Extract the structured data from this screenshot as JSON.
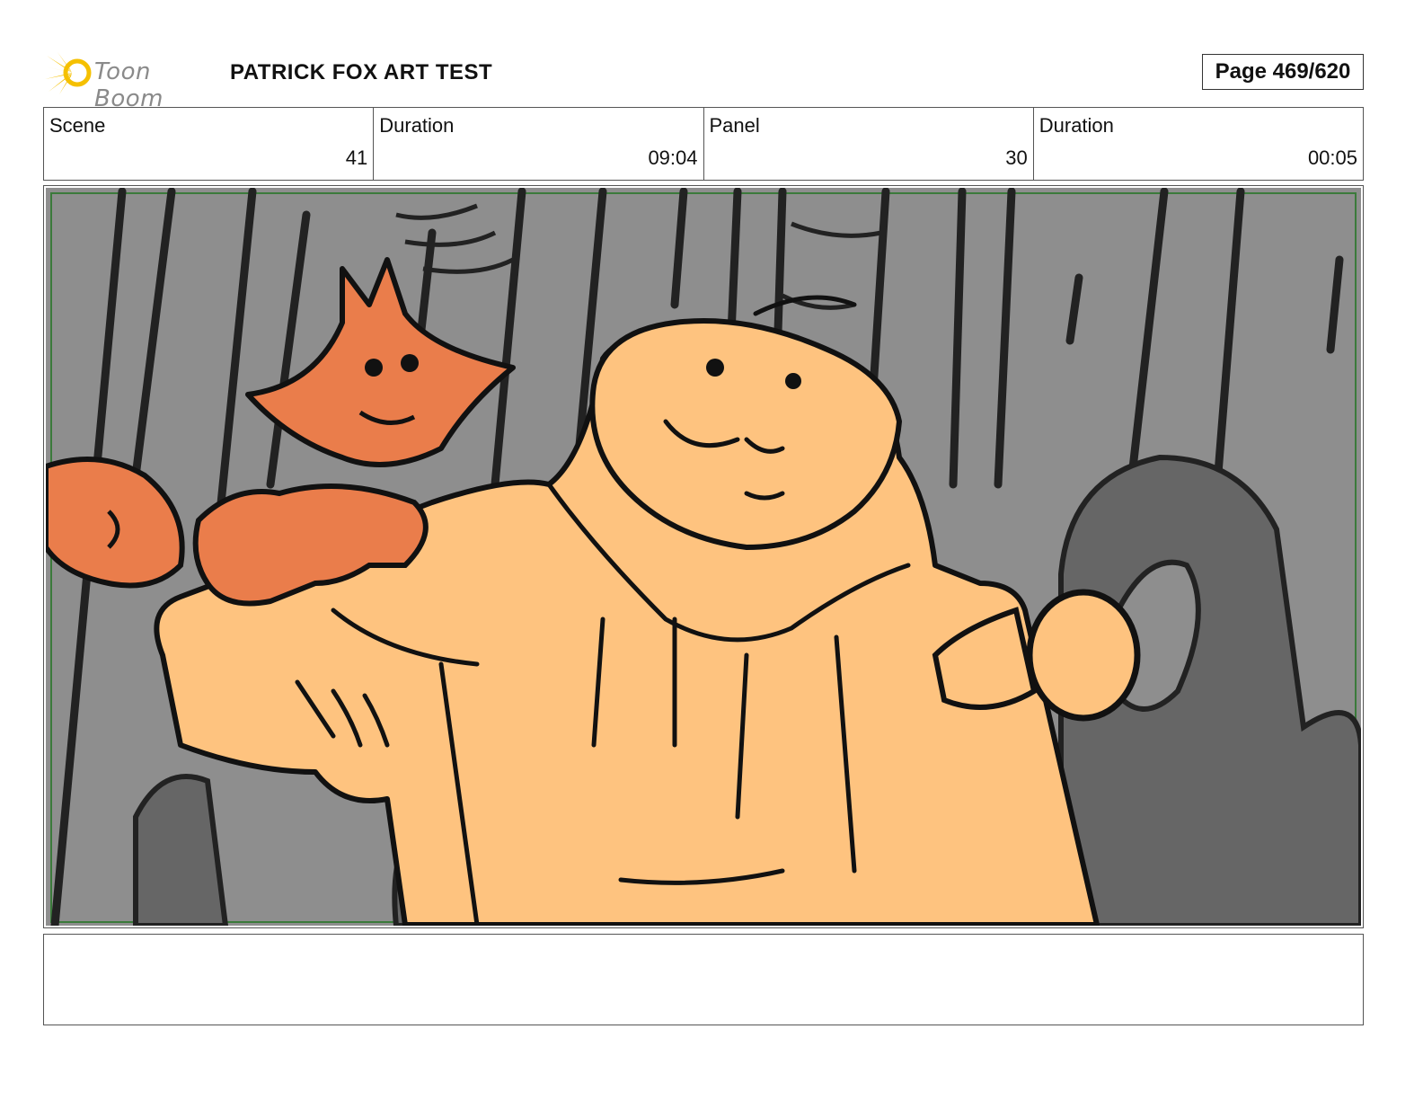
{
  "header": {
    "logo_text": "Toon Boom",
    "title": "PATRICK FOX ART TEST",
    "page": "Page 469/620"
  },
  "info": [
    {
      "label": "Scene",
      "value": "41"
    },
    {
      "label": "Duration",
      "value": "09:04"
    },
    {
      "label": "Panel",
      "value": "30"
    },
    {
      "label": "Duration",
      "value": "00:05"
    }
  ],
  "colors": {
    "background_gray": "#8e8e8e",
    "dark_gray": "#666666",
    "skin": "#fec37f",
    "fox_orange": "#ea7d4b",
    "frame_green": "#3b7a3b"
  },
  "notes": ""
}
